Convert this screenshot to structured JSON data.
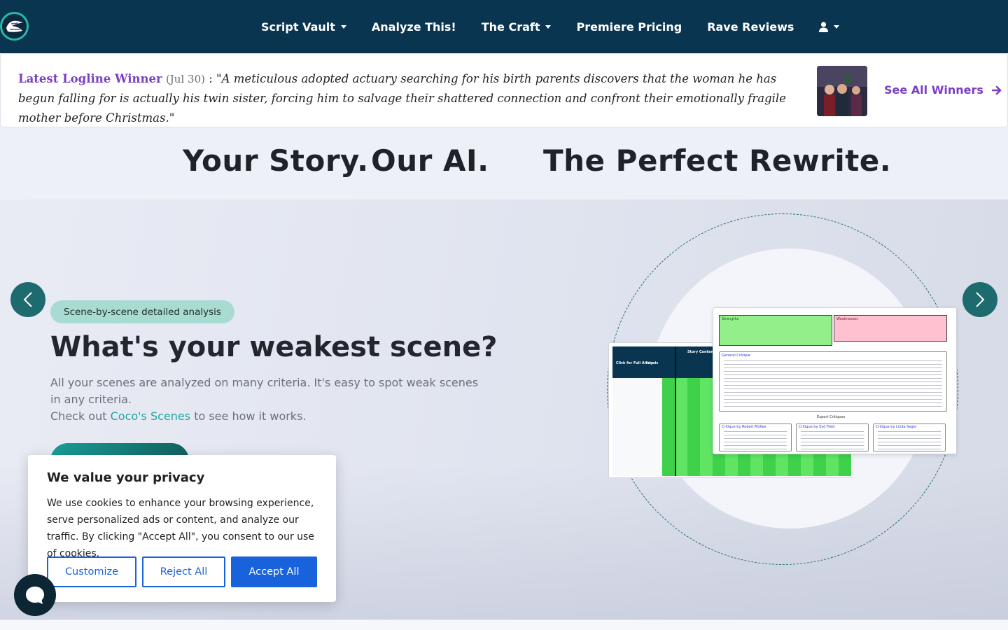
{
  "nav": {
    "items": [
      {
        "label": "Script Vault",
        "has_dropdown": true
      },
      {
        "label": "Analyze This!",
        "has_dropdown": false
      },
      {
        "label": "The Craft",
        "has_dropdown": true
      },
      {
        "label": "Premiere Pricing",
        "has_dropdown": false
      },
      {
        "label": "Rave Reviews",
        "has_dropdown": false
      }
    ],
    "user_icon": "user-icon"
  },
  "logline": {
    "label": "Latest Logline Winner",
    "date": "(Jul 30)",
    "separator": ":",
    "quote": "\"A meticulous adopted actuary searching for his birth parents discovers that the woman he has begun falling for is actually his twin sister, forcing him to salvage their shattered connection and confront their emotionally fragile mother before Christmas.\"",
    "see_all": "See All Winners"
  },
  "tagline": {
    "part1": "Your Story.",
    "part2": "Our AI.",
    "part3": "The Perfect Rewrite."
  },
  "hero": {
    "badge": "Scene-by-scene detailed analysis",
    "title": "What's your weakest scene?",
    "desc1": "All your scenes are analyzed on many criteria. It's easy to spot weak scenes in any criteria.",
    "desc2_prefix": "Check out",
    "desc2_link": "Coco's Scenes",
    "desc2_suffix": "to see how it works."
  },
  "mockup": {
    "strengths": "Strengths",
    "weaknesses": "Weaknesses",
    "general_critique": "General Critique",
    "expert_critiques": "Expert Critiques",
    "critique_1": "Critique by Robert McKee",
    "critique_2": "Critique by Syd Field",
    "critique_3": "Critique by Linda Seger",
    "click_for_full": "Click for Full Analysis",
    "tone": "Tone",
    "story_content": "Story Content"
  },
  "cookie": {
    "title": "We value your privacy",
    "text": "We use cookies to enhance your browsing experience, serve personalized ads or content, and analyze our traffic. By clicking \"Accept All\", you consent to our use of cookies.",
    "customize": "Customize",
    "reject": "Reject All",
    "accept": "Accept All"
  },
  "colors": {
    "navbar": "#0a3550",
    "accent_purple": "#7b3fc4",
    "teal": "#1d6b6e",
    "cookie_blue": "#1863dc"
  }
}
